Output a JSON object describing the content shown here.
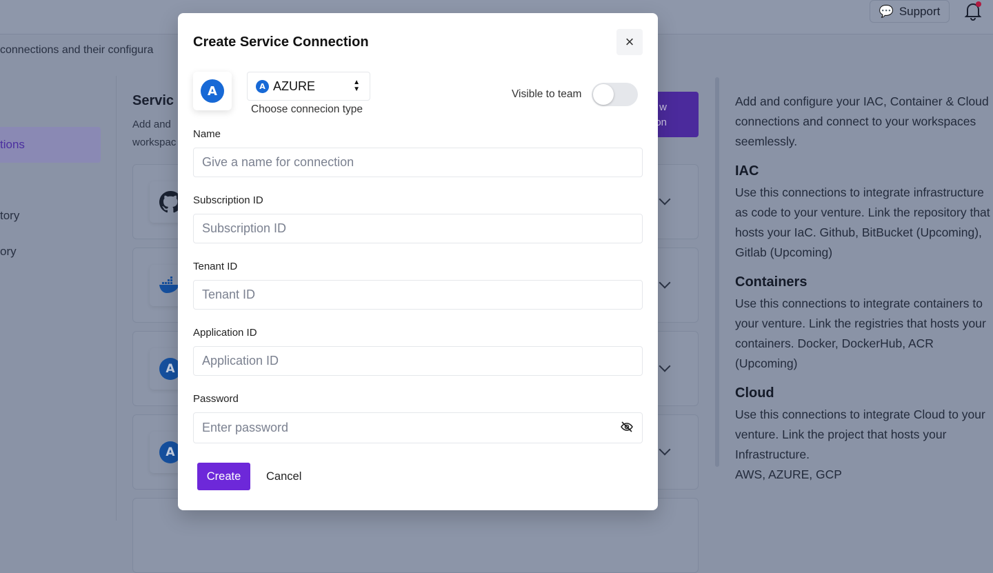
{
  "topbar": {
    "support_label": "Support"
  },
  "page": {
    "subtitle": "connections and their configura"
  },
  "sidebar": {
    "items": [
      {
        "label": "tions",
        "active": true
      },
      {
        "label": "tory"
      },
      {
        "label": "ory"
      }
    ]
  },
  "main": {
    "title": "Servic",
    "desc_line1": "Add and",
    "desc_line2": "workspac",
    "new_button_line1": "w",
    "new_button_line2": "on",
    "cards": [
      {
        "icon": "github-icon"
      },
      {
        "icon": "docker-icon"
      },
      {
        "icon": "azure-icon"
      },
      {
        "icon": "azure-icon"
      }
    ]
  },
  "info": {
    "intro": "Add and configure your IAC, Container & Cloud connections and connect to your workspaces seemlessly.",
    "sections": [
      {
        "title": "IAC",
        "text": "Use this connections to integrate infrastructure as code to your venture. Link the repository that hosts your IaC. Github, BitBucket (Upcoming), Gitlab (Upcoming)"
      },
      {
        "title": "Containers",
        "text": "Use this connections to integrate containers to your venture. Link the registries that hosts your containers. Docker, DockerHub, ACR (Upcoming)"
      },
      {
        "title": "Cloud",
        "text": "Use this connections to integrate Cloud to your venture. Link the project that hosts your Infrastructure."
      },
      {
        "title": "",
        "text": "AWS, AZURE, GCP"
      }
    ]
  },
  "modal": {
    "title": "Create Service Connection",
    "close": "×",
    "connection_type": {
      "value": "AZURE",
      "caption": "Choose connecion type",
      "logo_letter": "A"
    },
    "visible_label": "Visible to team",
    "visible": false,
    "fields": [
      {
        "label": "Name",
        "placeholder": "Give a name for connection"
      },
      {
        "label": "Subscription ID",
        "placeholder": "Subscription ID"
      },
      {
        "label": "Tenant ID",
        "placeholder": "Tenant ID"
      },
      {
        "label": "Application ID",
        "placeholder": "Application ID"
      },
      {
        "label": "Password",
        "placeholder": "Enter password"
      }
    ],
    "create_label": "Create",
    "cancel_label": "Cancel"
  },
  "colors": {
    "accent": "#6d28d9",
    "azure": "#1769d6"
  }
}
